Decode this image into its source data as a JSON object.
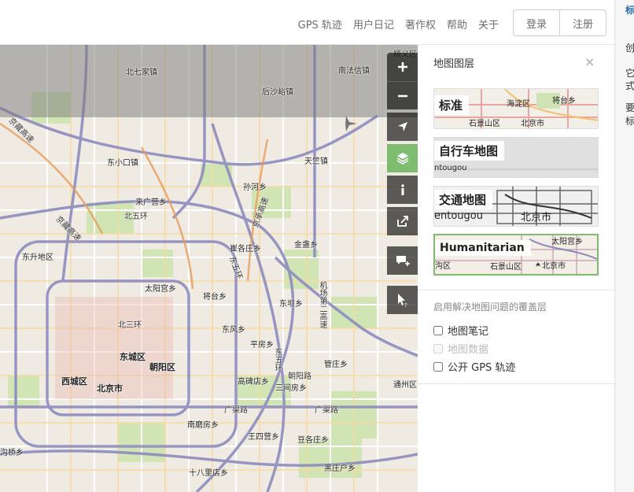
{
  "header": {
    "nav": [
      "GPS 轨迹",
      "用户日记",
      "著作权",
      "帮助",
      "关于"
    ],
    "login": "登录",
    "signup": "注册"
  },
  "map": {
    "labels": [
      "顺义区",
      "北七家镇",
      "后沙峪镇",
      "南法信镇",
      "京藏高速",
      "东小口镇",
      "天竺镇",
      "孙河乡",
      "京承高速",
      "来广营乡",
      "北五环",
      "京藏高速",
      "崔各庄乡",
      "金盏乡",
      "东升地区",
      "东五环",
      "太阳宫乡",
      "将台乡",
      "东坝乡",
      "机场第二高速",
      "北三环",
      "东风乡",
      "平房乡",
      "东城区",
      "朝阳区",
      "东五环",
      "管庄乡",
      "西城区",
      "北京市",
      "高碑店乡",
      "三间房乡",
      "朝阳路",
      "通州区",
      "广渠路",
      "广渠路",
      "南磨房乡",
      "王四营乡",
      "豆各庄乡",
      "沟桥乡",
      "十八里店乡",
      "黑庄户乡"
    ]
  },
  "controls": [
    "zoom-in",
    "zoom-out",
    "locate",
    "layers",
    "info",
    "share",
    "add-note",
    "query"
  ],
  "panel": {
    "title": "地图图层",
    "close": "×",
    "layers": [
      {
        "name": "标准",
        "places": [
          "海淀区",
          "将台乡",
          "石景山区",
          "北京市"
        ],
        "active": false
      },
      {
        "name": "自行车地图",
        "places": [
          "ntougou"
        ],
        "active": false
      },
      {
        "name": "交通地图",
        "places": [
          "北京市",
          "entougou"
        ],
        "active": false
      },
      {
        "name": "Humanitarian",
        "places": [
          "太阳宫乡",
          "沟区",
          "石景山区",
          "北京市"
        ],
        "active": true
      }
    ],
    "overlay_heading": "启用解决地图问题的覆盖层",
    "overlays": [
      {
        "label": "地图笔记",
        "checked": false,
        "disabled": false
      },
      {
        "label": "地图数据",
        "checked": false,
        "disabled": true
      },
      {
        "label": "公开 GPS 轨迹",
        "checked": false,
        "disabled": false
      }
    ]
  },
  "strip": [
    "标",
    "创",
    "它",
    "式",
    "要",
    "标"
  ]
}
